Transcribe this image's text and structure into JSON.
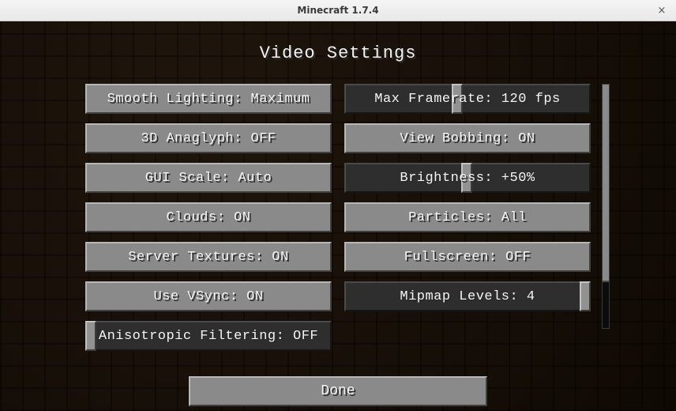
{
  "window": {
    "title": "Minecraft 1.7.4"
  },
  "screen": {
    "title": "Video Settings"
  },
  "left": {
    "0": {
      "label": "Smooth Lighting: Maximum"
    },
    "1": {
      "label": "3D Anaglyph: OFF"
    },
    "2": {
      "label": "GUI Scale: Auto"
    },
    "3": {
      "label": "Clouds: ON"
    },
    "4": {
      "label": "Server Textures: ON"
    },
    "5": {
      "label": "Use VSync: ON"
    },
    "6": {
      "label": "Anisotropic Filtering: OFF"
    }
  },
  "right": {
    "0": {
      "label": "Max Framerate: 120 fps"
    },
    "1": {
      "label": "View Bobbing: ON"
    },
    "2": {
      "label": "Brightness: +50%"
    },
    "3": {
      "label": "Particles: All"
    },
    "4": {
      "label": "Fullscreen: OFF"
    },
    "5": {
      "label": "Mipmap Levels: 4"
    }
  },
  "done": {
    "label": "Done"
  }
}
